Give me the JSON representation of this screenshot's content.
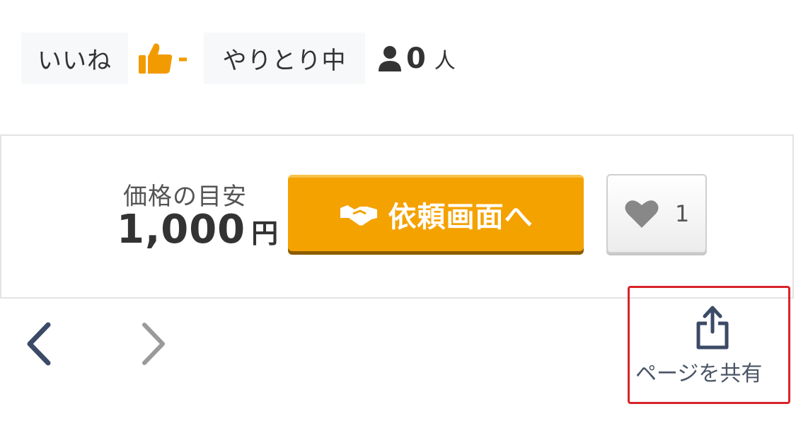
{
  "stats": {
    "like_label": "いいね",
    "like_value": "-",
    "deal_label": "やりとり中",
    "people_count": "0",
    "people_unit": "人"
  },
  "price": {
    "label": "価格の目安",
    "value": "1,000",
    "unit": "円"
  },
  "actions": {
    "request_label": "依頼画面へ",
    "favorite_count": "1",
    "share_label": "ページを共有"
  },
  "colors": {
    "accent": "#f4a200",
    "highlight_border": "#d9232b",
    "nav_active": "#3b4a66",
    "nav_inactive": "#9a9a9a"
  },
  "icons": [
    "thumbs-up-icon",
    "person-icon",
    "handshake-icon",
    "heart-icon",
    "chevron-left-icon",
    "chevron-right-icon",
    "share-icon"
  ]
}
